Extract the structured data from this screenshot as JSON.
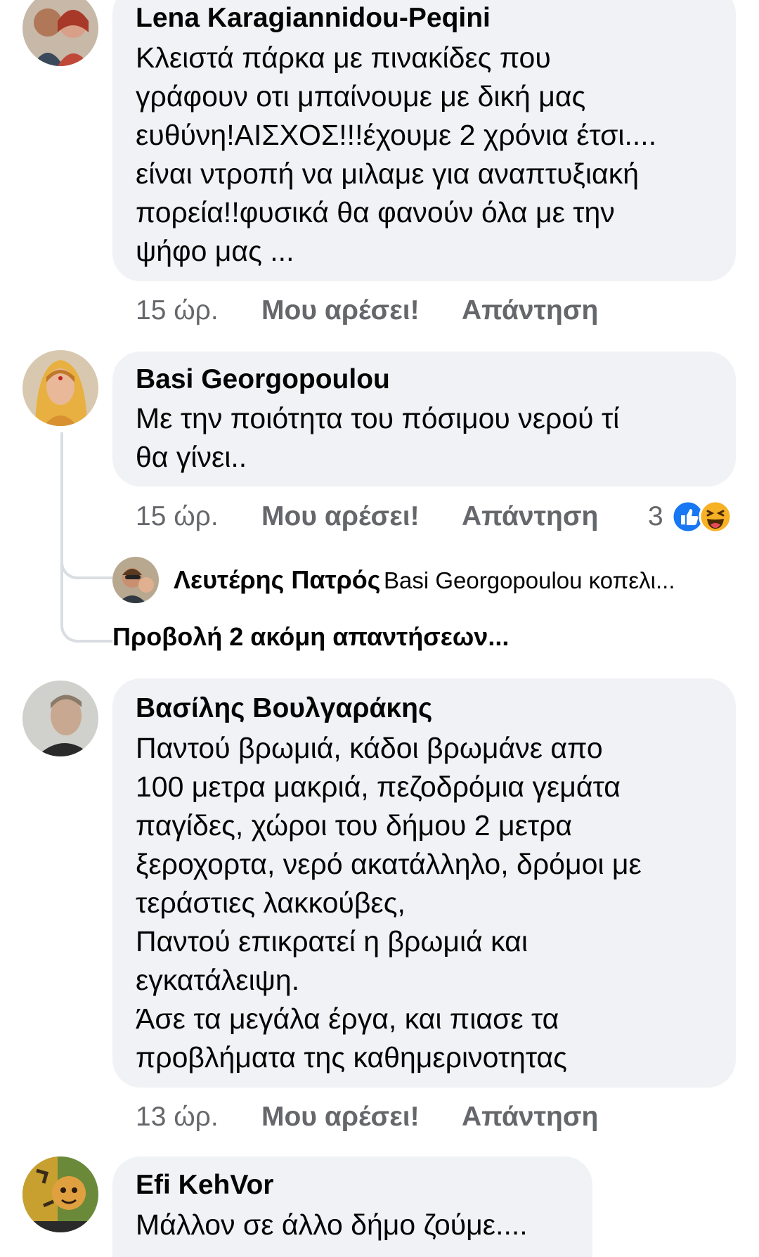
{
  "comments": [
    {
      "author": "Lena Karagiannidou-Peqini",
      "text": "Κλειστά πάρκα με πινακίδες που\nγράφουν οτι μπαίνουμε με δική μας\nευθύνη!ΑΙΣΧΟΣ!!!έχουμε 2 χρόνια έτσι....\nείναι ντροπή να μιλαμε για αναπτυξιακή\nπορεία!!φυσικά θα φανούν όλα με την\nψήφο μας ...",
      "time": "15 ώρ.",
      "like_label": "Μου αρέσει!",
      "reply_label": "Απάντηση"
    },
    {
      "author": "Basi Georgopoulou",
      "text": "Με την ποιότητα του πόσιμου νερού τί\nθα γίνει..",
      "time": "15 ώρ.",
      "like_label": "Μου αρέσει!",
      "reply_label": "Απάντηση",
      "reaction_count": "3",
      "reply_preview": {
        "author": "Λευτέρης Πατρός",
        "text": "Basi Georgopoulou κοπελι..."
      },
      "more_replies": "Προβολή 2 ακόμη απαντήσεων..."
    },
    {
      "author": "Βασίλης Βουλγαράκης",
      "text": "Παντού βρωμιά,   κάδοι βρωμάνε απο\n100 μετρα μακριά,  πεζοδρόμια γεμάτα\nπαγίδες, χώροι του δήμου 2 μετρα\nξεροχορτα, νερό ακατάλληλο, δρόμοι  με\nτεράστιες  λακκούβες,\nΠαντού  επικρατεί  η βρωμιά και\nεγκατάλειψη.\nΆσε τα μεγάλα έργα, και πιασε τα\nπροβλήματα της καθημερινοτητας",
      "time": "13 ώρ.",
      "like_label": "Μου αρέσει!",
      "reply_label": "Απάντηση"
    },
    {
      "author": "Efi KehVor",
      "text": "Μάλλον σε άλλο δήμο ζούμε...."
    }
  ],
  "colors": {
    "bubble": "#f0f2f5",
    "meta_text": "#65676b",
    "like_blue": "#1877f2",
    "haha_yellow": "#f7b125"
  },
  "icons": [
    "like-reaction-icon",
    "haha-reaction-icon"
  ]
}
